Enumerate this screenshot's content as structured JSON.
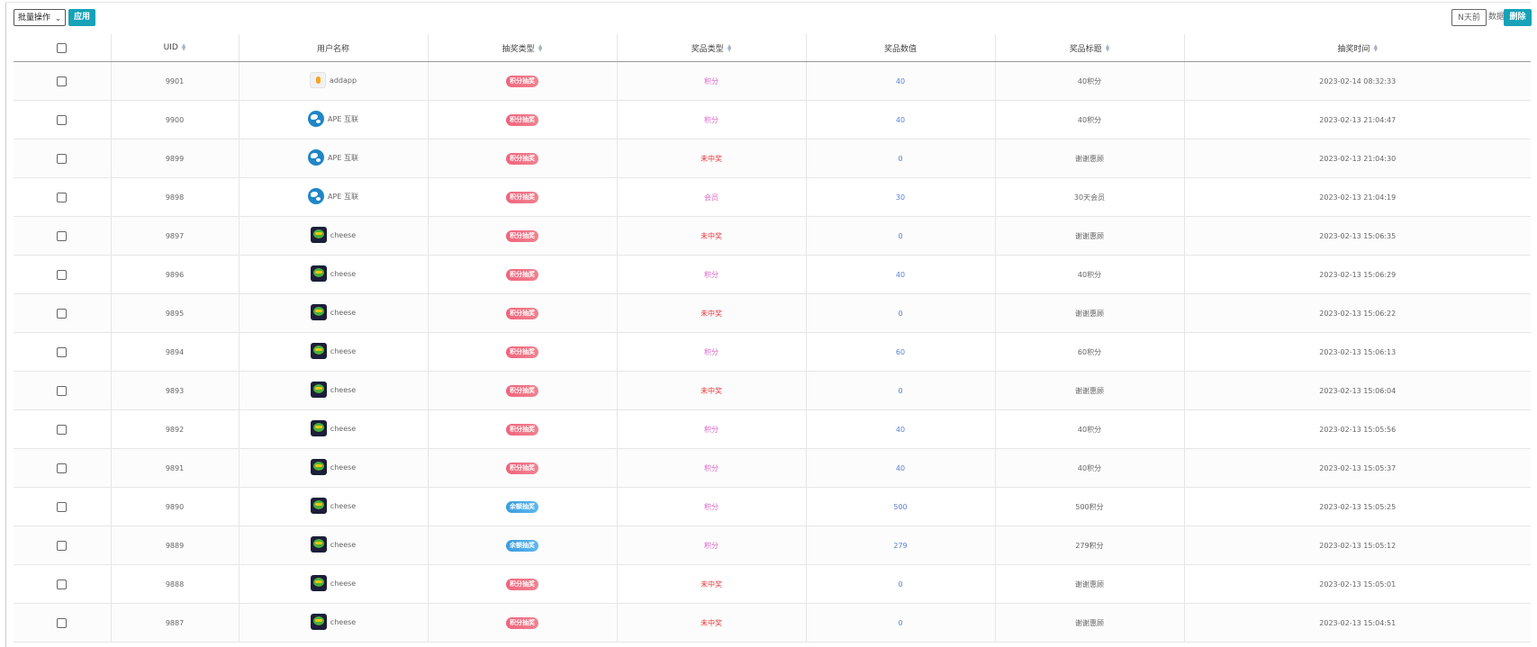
{
  "toolbar": {
    "batch_select_value": "批量操作",
    "apply_label": "应用",
    "ndays_placeholder": "N天前",
    "ndays_suffix": "数据",
    "delete_label": "删除"
  },
  "columns": [
    {
      "key": "select",
      "label": ""
    },
    {
      "key": "uid",
      "label": "UID",
      "sortable": true
    },
    {
      "key": "username",
      "label": "用户名称",
      "sortable": false
    },
    {
      "key": "draw_type",
      "label": "抽奖类型",
      "sortable": true
    },
    {
      "key": "prize_type",
      "label": "奖品类型",
      "sortable": true
    },
    {
      "key": "prize_qty",
      "label": "奖品数值",
      "sortable": false
    },
    {
      "key": "prize_title",
      "label": "奖品标题",
      "sortable": true
    },
    {
      "key": "draw_time",
      "label": "抽奖时间",
      "sortable": true
    }
  ],
  "colors": {
    "accent": "#17a2b8",
    "points_badge": "#f0647c",
    "balance_badge": "#3a9be0",
    "prize_points": "#d966c8",
    "prize_none": "#e8353b",
    "number_link": "#5b7fd6"
  },
  "rows": [
    {
      "uid": "9901",
      "avatar": "addapp-avatar",
      "username": "addapp",
      "draw_type": "积分抽奖",
      "draw_kind": "points",
      "prize_type": "积分",
      "prize_kind": "points",
      "qty": "40",
      "title": "40积分",
      "time": "2023-02-14 08:32:33"
    },
    {
      "uid": "9900",
      "avatar": "globe-avatar",
      "username": "APE 互联",
      "draw_type": "积分抽奖",
      "draw_kind": "points",
      "prize_type": "积分",
      "prize_kind": "points",
      "qty": "40",
      "title": "40积分",
      "time": "2023-02-13 21:04:47"
    },
    {
      "uid": "9899",
      "avatar": "globe-avatar",
      "username": "APE 互联",
      "draw_type": "积分抽奖",
      "draw_kind": "points",
      "prize_type": "未中奖",
      "prize_kind": "none",
      "qty": "0",
      "title": "谢谢惠顾",
      "time": "2023-02-13 21:04:30"
    },
    {
      "uid": "9898",
      "avatar": "globe-avatar",
      "username": "APE 互联",
      "draw_type": "积分抽奖",
      "draw_kind": "points",
      "prize_type": "会员",
      "prize_kind": "member",
      "qty": "30",
      "title": "30天会员",
      "time": "2023-02-13 21:04:19"
    },
    {
      "uid": "9897",
      "avatar": "cheese-avatar",
      "username": "cheese",
      "draw_type": "积分抽奖",
      "draw_kind": "points",
      "prize_type": "未中奖",
      "prize_kind": "none",
      "qty": "0",
      "title": "谢谢惠顾",
      "time": "2023-02-13 15:06:35"
    },
    {
      "uid": "9896",
      "avatar": "cheese-avatar",
      "username": "cheese",
      "draw_type": "积分抽奖",
      "draw_kind": "points",
      "prize_type": "积分",
      "prize_kind": "points",
      "qty": "40",
      "title": "40积分",
      "time": "2023-02-13 15:06:29"
    },
    {
      "uid": "9895",
      "avatar": "cheese-avatar",
      "username": "cheese",
      "draw_type": "积分抽奖",
      "draw_kind": "points",
      "prize_type": "未中奖",
      "prize_kind": "none",
      "qty": "0",
      "title": "谢谢惠顾",
      "time": "2023-02-13 15:06:22"
    },
    {
      "uid": "9894",
      "avatar": "cheese-avatar",
      "username": "cheese",
      "draw_type": "积分抽奖",
      "draw_kind": "points",
      "prize_type": "积分",
      "prize_kind": "points",
      "qty": "60",
      "title": "60积分",
      "time": "2023-02-13 15:06:13"
    },
    {
      "uid": "9893",
      "avatar": "cheese-avatar",
      "username": "cheese",
      "draw_type": "积分抽奖",
      "draw_kind": "points",
      "prize_type": "未中奖",
      "prize_kind": "none",
      "qty": "0",
      "title": "谢谢惠顾",
      "time": "2023-02-13 15:06:04"
    },
    {
      "uid": "9892",
      "avatar": "cheese-avatar",
      "username": "cheese",
      "draw_type": "积分抽奖",
      "draw_kind": "points",
      "prize_type": "积分",
      "prize_kind": "points",
      "qty": "40",
      "title": "40积分",
      "time": "2023-02-13 15:05:56"
    },
    {
      "uid": "9891",
      "avatar": "cheese-avatar",
      "username": "cheese",
      "draw_type": "积分抽奖",
      "draw_kind": "points",
      "prize_type": "积分",
      "prize_kind": "points",
      "qty": "40",
      "title": "40积分",
      "time": "2023-02-13 15:05:37"
    },
    {
      "uid": "9890",
      "avatar": "cheese-avatar",
      "username": "cheese",
      "draw_type": "余额抽奖",
      "draw_kind": "balance",
      "prize_type": "积分",
      "prize_kind": "points",
      "qty": "500",
      "title": "500积分",
      "time": "2023-02-13 15:05:25"
    },
    {
      "uid": "9889",
      "avatar": "cheese-avatar",
      "username": "cheese",
      "draw_type": "余额抽奖",
      "draw_kind": "balance",
      "prize_type": "积分",
      "prize_kind": "points",
      "qty": "279",
      "title": "279积分",
      "time": "2023-02-13 15:05:12"
    },
    {
      "uid": "9888",
      "avatar": "cheese-avatar",
      "username": "cheese",
      "draw_type": "积分抽奖",
      "draw_kind": "points",
      "prize_type": "未中奖",
      "prize_kind": "none",
      "qty": "0",
      "title": "谢谢惠顾",
      "time": "2023-02-13 15:05:01"
    },
    {
      "uid": "9887",
      "avatar": "cheese-avatar",
      "username": "cheese",
      "draw_type": "积分抽奖",
      "draw_kind": "points",
      "prize_type": "未中奖",
      "prize_kind": "none",
      "qty": "0",
      "title": "谢谢惠顾",
      "time": "2023-02-13 15:04:51"
    }
  ]
}
